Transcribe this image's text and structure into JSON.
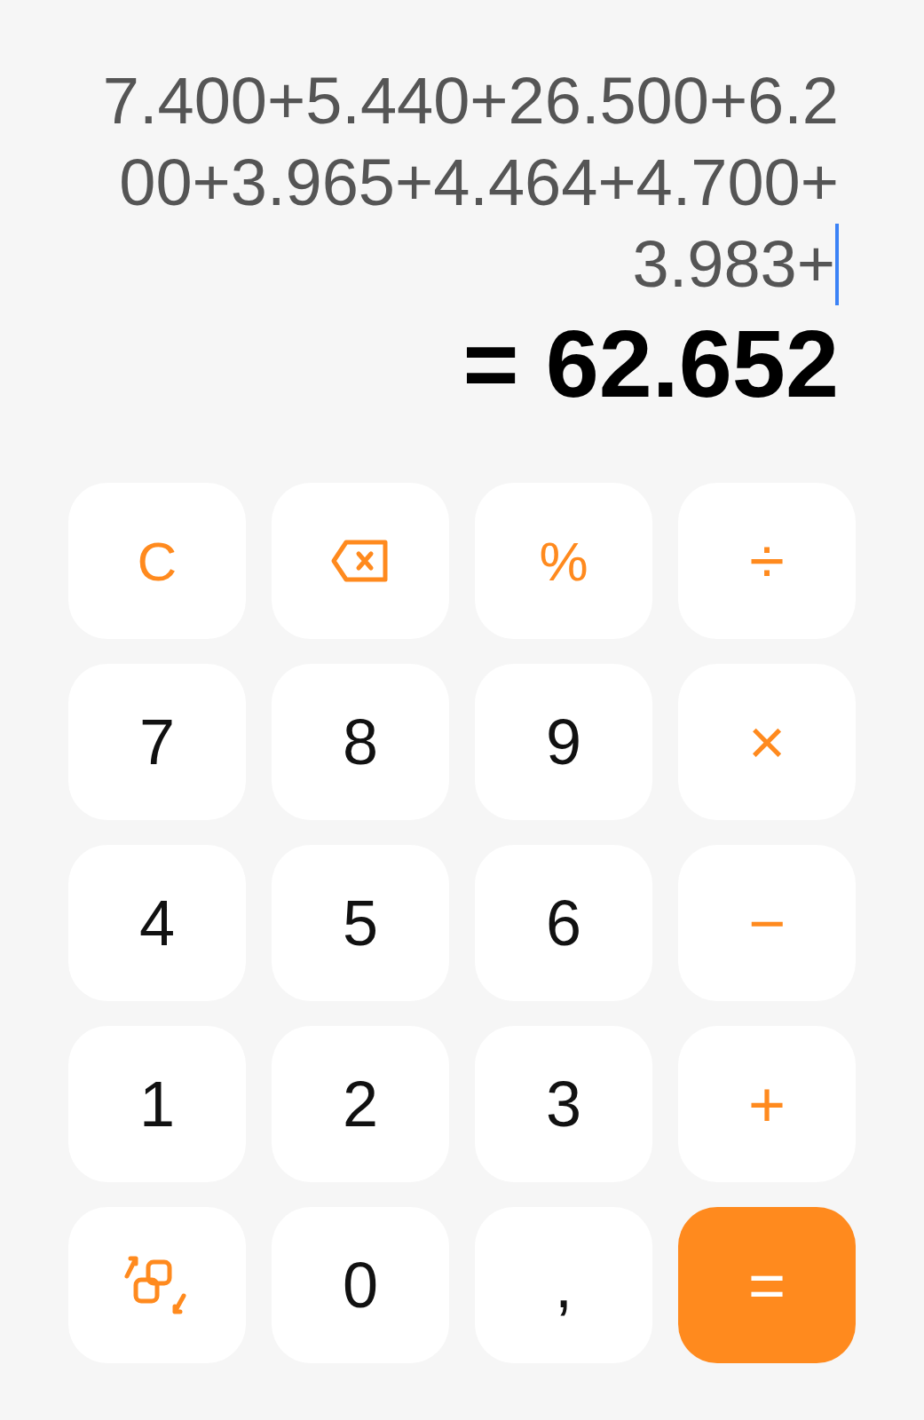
{
  "display": {
    "expression_lines": [
      "7.400+5.440+26.500+6.2",
      "00+3.965+4.464+4.700+",
      "3.983+"
    ],
    "cursor_at_end": true,
    "result": "= 62.652"
  },
  "keys": [
    {
      "kind": "function",
      "label": "C"
    },
    {
      "kind": "backspace"
    },
    {
      "kind": "function",
      "label": "%"
    },
    {
      "kind": "operator",
      "label": "÷"
    },
    {
      "kind": "digit",
      "label": "7"
    },
    {
      "kind": "digit",
      "label": "8"
    },
    {
      "kind": "digit",
      "label": "9"
    },
    {
      "kind": "operator",
      "label": "×"
    },
    {
      "kind": "digit",
      "label": "4"
    },
    {
      "kind": "digit",
      "label": "5"
    },
    {
      "kind": "digit",
      "label": "6"
    },
    {
      "kind": "operator",
      "label": "−"
    },
    {
      "kind": "digit",
      "label": "1"
    },
    {
      "kind": "digit",
      "label": "2"
    },
    {
      "kind": "digit",
      "label": "3"
    },
    {
      "kind": "operator",
      "label": "+"
    },
    {
      "kind": "convert"
    },
    {
      "kind": "digit",
      "label": "0"
    },
    {
      "kind": "digit",
      "label": ","
    },
    {
      "kind": "equals",
      "label": "="
    }
  ]
}
